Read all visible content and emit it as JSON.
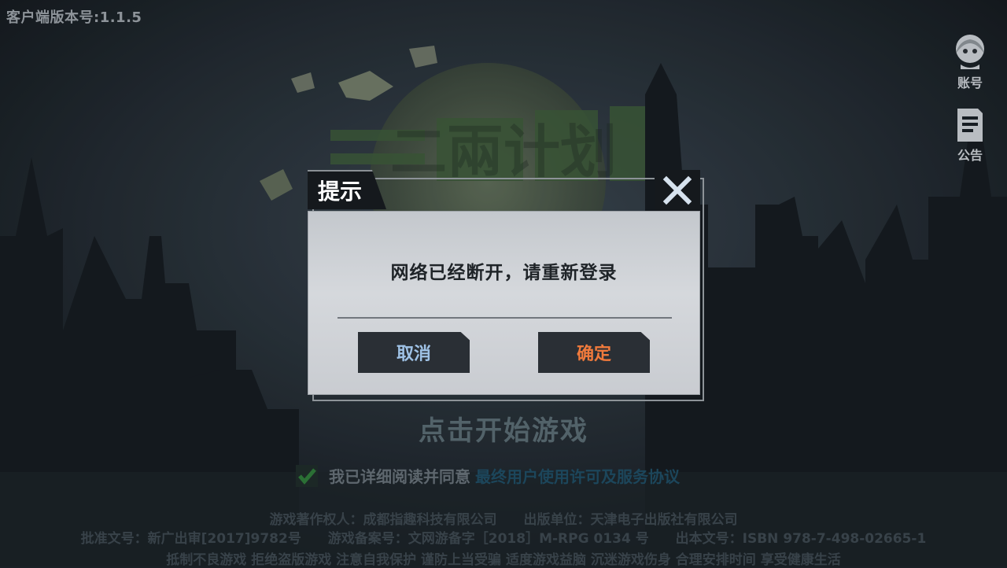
{
  "version_label": "客户端版本号:1.1.5",
  "side_buttons": {
    "account": {
      "label": "账号",
      "icon": "avatar-icon"
    },
    "notice": {
      "label": "公告",
      "icon": "notice-icon"
    }
  },
  "background": {
    "logo_text": "二兩计划",
    "login_hint": "点击开始游戏",
    "agreement": {
      "prefix": "我已详细阅读并同意",
      "link": "最终用户使用许可及服务协议"
    },
    "footer": {
      "line1": [
        "游戏著作权人：成都指趣科技有限公司",
        "出版单位：天津电子出版社有限公司"
      ],
      "line2": [
        "批准文号：新广出审[2017]9782号",
        "游戏备案号：文网游备字［2018］M-RPG 0134 号",
        "出本文号：ISBN 978-7-498-02665-1"
      ],
      "line3": "抵制不良游戏  拒绝盗版游戏  注意自我保护  谨防上当受骗  适度游戏益脑  沉迷游戏伤身  合理安排时间  享受健康生活"
    }
  },
  "dialog": {
    "title": "提示",
    "message": "网络已经断开，请重新登录",
    "cancel_label": "取消",
    "confirm_label": "确定",
    "close_icon": "close-icon"
  },
  "colors": {
    "accent_cancel": "#9fc2e6",
    "accent_confirm": "#f07a3c",
    "dialog_panel": "#d0d3d7",
    "dark_panel": "#15191d"
  }
}
